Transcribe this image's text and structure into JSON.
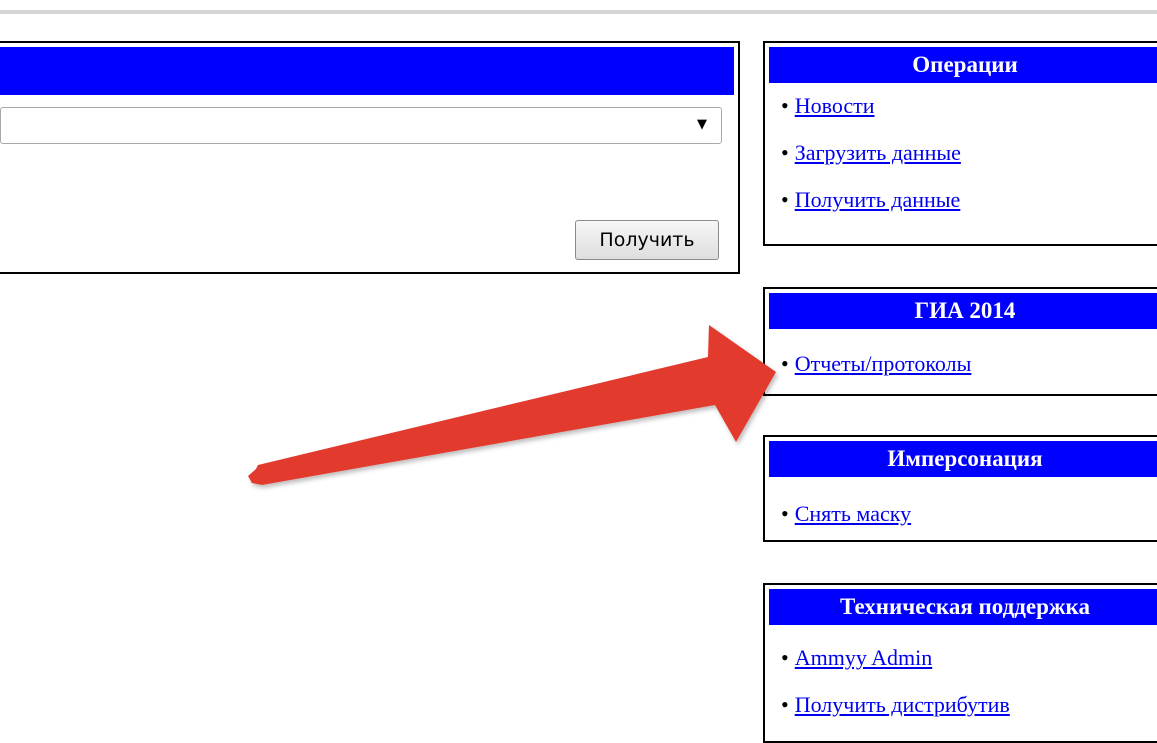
{
  "query_panel": {
    "button_label": "Получить",
    "select_value": ""
  },
  "blocks": [
    {
      "title": "Операции",
      "links": [
        "Новости",
        "Загрузить данные",
        "Получить данные"
      ]
    },
    {
      "title": "ГИА 2014",
      "links": [
        "Отчеты/протоколы"
      ]
    },
    {
      "title": "Имперсонация",
      "links": [
        "Снять маску"
      ]
    },
    {
      "title": "Техническая поддержка",
      "links": [
        "Ammyy Admin",
        "Получить дистрибутив"
      ]
    }
  ],
  "colors": {
    "header_blue": "#0000ff",
    "link_blue": "#0000ee",
    "arrow_red": "#e23b2e"
  },
  "icons": {
    "select_arrow": "chevron-down-icon",
    "annotation": "red-arrow-icon"
  }
}
